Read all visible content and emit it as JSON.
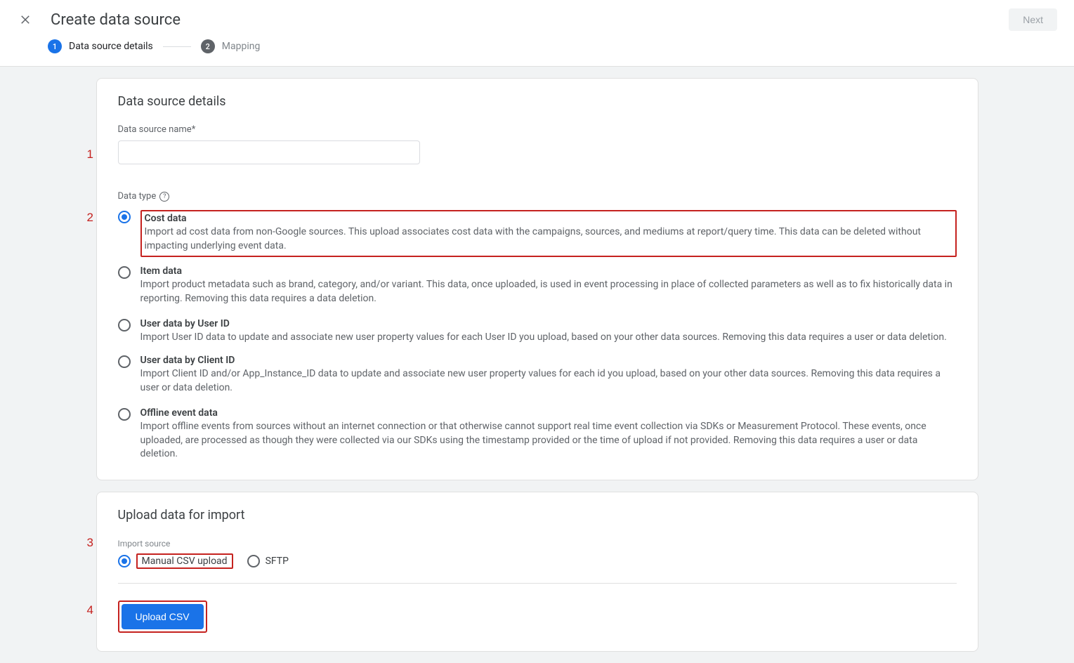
{
  "header": {
    "title": "Create data source",
    "next_button": "Next"
  },
  "stepper": {
    "step1": {
      "num": "1",
      "label": "Data source details"
    },
    "step2": {
      "num": "2",
      "label": "Mapping"
    }
  },
  "details": {
    "card_title": "Data source details",
    "name_label": "Data source name*",
    "name_value": "",
    "data_type_label": "Data type",
    "options": [
      {
        "title": "Cost data",
        "desc": "Import ad cost data from non-Google sources. This upload associates cost data with the campaigns, sources, and mediums at report/query time. This data can be deleted without impacting underlying event data."
      },
      {
        "title": "Item data",
        "desc": "Import product metadata such as brand, category, and/or variant. This data, once uploaded, is used in event processing in place of collected parameters as well as to fix historically data in reporting. Removing this data requires a data deletion."
      },
      {
        "title": "User data by User ID",
        "desc": "Import User ID data to update and associate new user property values for each User ID you upload, based on your other data sources. Removing this data requires a user or data deletion."
      },
      {
        "title": "User data by Client ID",
        "desc": "Import Client ID and/or App_Instance_ID data to update and associate new user property values for each id you upload, based on your other data sources. Removing this data requires a user or data deletion."
      },
      {
        "title": "Offline event data",
        "desc": "Import offline events from sources without an internet connection or that otherwise cannot support real time event collection via SDKs or Measurement Protocol. These events, once uploaded, are processed as though they were collected via our SDKs using the timestamp provided or the time of upload if not provided. Removing this data requires a user or data deletion."
      }
    ]
  },
  "upload": {
    "card_title": "Upload data for import",
    "import_source_label": "Import source",
    "option_csv": "Manual CSV upload",
    "option_sftp": "SFTP",
    "upload_button": "Upload CSV"
  },
  "annotations": {
    "a1": "1",
    "a2": "2",
    "a3": "3",
    "a4": "4"
  }
}
